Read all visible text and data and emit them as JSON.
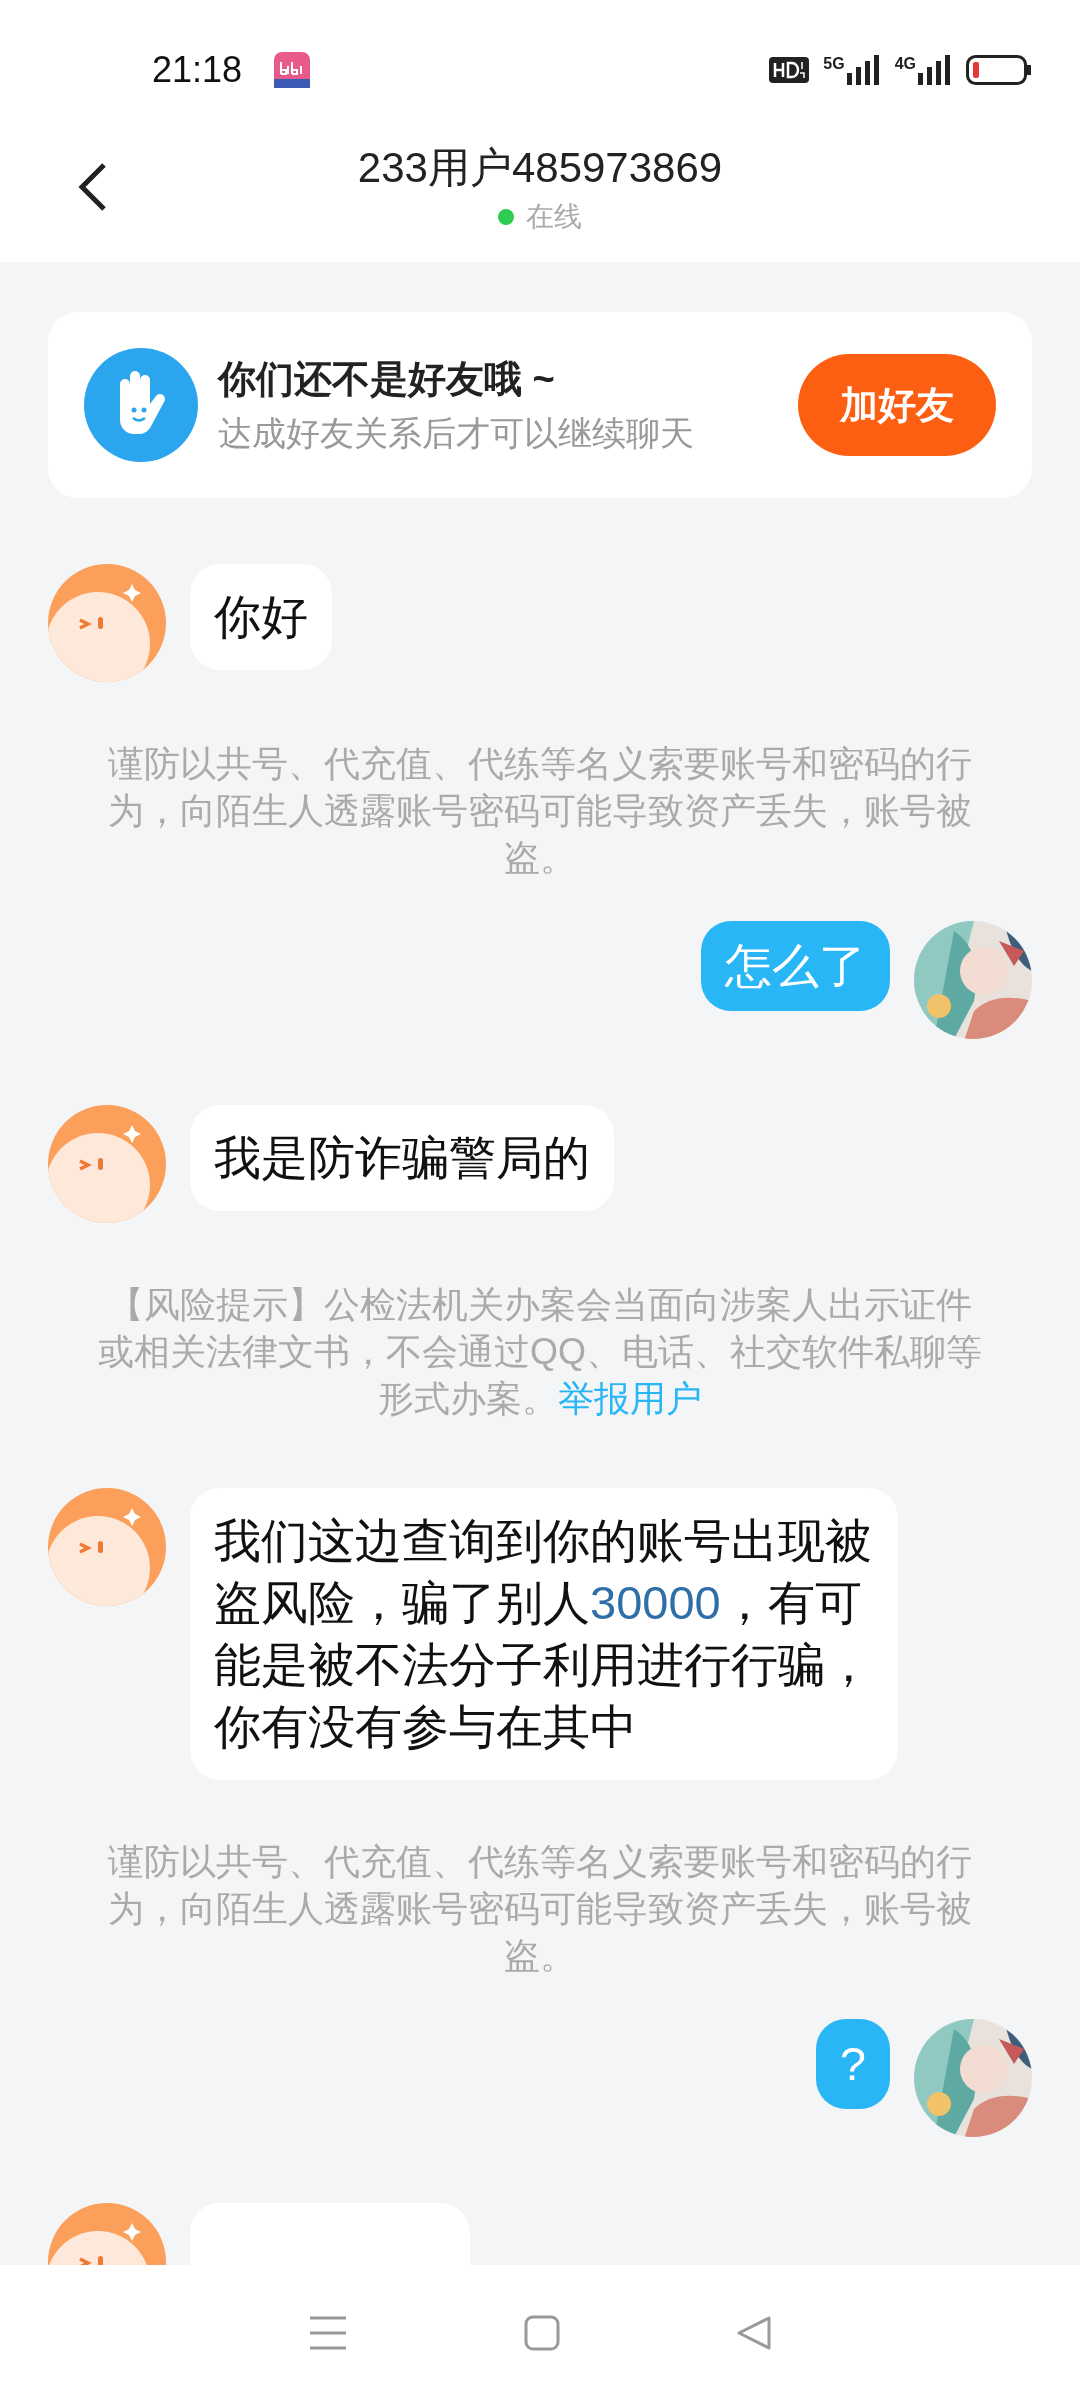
{
  "status_bar": {
    "time": "21:18",
    "networks": [
      "5G",
      "4G"
    ],
    "battery_low": true
  },
  "header": {
    "title": "233用户485973869",
    "status": "在线",
    "online": true
  },
  "friend_card": {
    "title": "你们还不是好友哦 ~",
    "subtitle": "达成好友关系后才可以继续聊天",
    "button": "加好友"
  },
  "messages": [
    {
      "kind": "incoming",
      "segments": [
        {
          "kind": "plain",
          "text": "你好"
        }
      ]
    },
    {
      "kind": "notice",
      "segments": [
        {
          "kind": "plain",
          "text": "谨防以共号、代充值、代练等名义索要账号和密码的行为，向陌生人透露账号密码可能导致资产丢失，账号被盗。"
        }
      ]
    },
    {
      "kind": "outgoing",
      "segments": [
        {
          "kind": "plain",
          "text": "怎么了"
        }
      ]
    },
    {
      "kind": "incoming",
      "segments": [
        {
          "kind": "plain",
          "text": "我是防诈骗警局的"
        }
      ]
    },
    {
      "kind": "notice",
      "segments": [
        {
          "kind": "plain",
          "text": "【风险提示】公检法机关办案会当面向涉案人出示证件或相关法律文书，不会通过QQ、电话、社交软件私聊等形式办案。"
        },
        {
          "kind": "link",
          "text": "举报用户"
        }
      ]
    },
    {
      "kind": "incoming",
      "segments": [
        {
          "kind": "plain",
          "text": "我们这边查询到你的账号出现被盗风险，骗了别人"
        },
        {
          "kind": "link",
          "text": "30000"
        },
        {
          "kind": "plain",
          "text": "，有可能是被不法分子利用进行行骗，你有没有参与在其中"
        }
      ]
    },
    {
      "kind": "notice",
      "segments": [
        {
          "kind": "plain",
          "text": "谨防以共号、代充值、代练等名义索要账号和密码的行为，向陌生人透露账号密码可能导致资产丢失，账号被盗。"
        }
      ]
    },
    {
      "kind": "outgoing",
      "segments": [
        {
          "kind": "plain",
          "text": "?"
        }
      ]
    },
    {
      "kind": "incoming"
    }
  ]
}
